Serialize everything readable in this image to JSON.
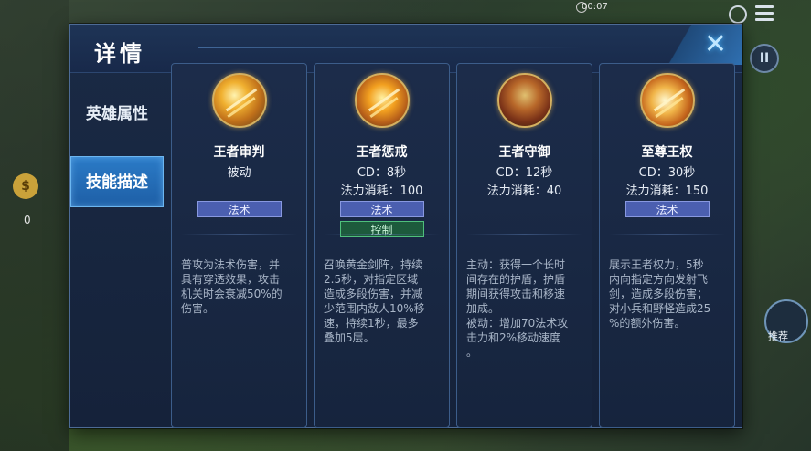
{
  "hud": {
    "time": "00:07",
    "gold_value": "0",
    "right_button_label": "推荐"
  },
  "modal": {
    "title": "详情",
    "nav": [
      {
        "label": "英雄属性"
      },
      {
        "label": "技能描述"
      }
    ],
    "active_nav_index": 1
  },
  "skills": [
    {
      "name": "王者审判",
      "meta_line1": "被动",
      "meta_line2": "",
      "tags": [
        "法术"
      ],
      "description": "普攻为法术伤害，并\n具有穿透效果，攻击\n机关时会衰减50%的\n伤害。"
    },
    {
      "name": "王者惩戒",
      "meta_line1": "CD：8秒",
      "meta_line2": "法力消耗：100",
      "tags": [
        "法术",
        "控制"
      ],
      "description": "召唤黄金剑阵，持续\n2.5秒，对指定区域\n造成多段伤害，并减\n少范围内敌人10%移\n速，持续1秒，最多\n叠加5层。"
    },
    {
      "name": "王者守御",
      "meta_line1": "CD：12秒",
      "meta_line2": "法力消耗：40",
      "tags": [],
      "description": "主动：获得一个长时\n间存在的护盾，护盾\n期间获得攻击和移速\n加成。\n被动：增加70法术攻\n击力和2%移动速度\n。"
    },
    {
      "name": "至尊王权",
      "meta_line1": "CD：30秒",
      "meta_line2": "法力消耗：150",
      "tags": [
        "法术"
      ],
      "description": "展示王者权力，5秒\n内向指定方向发射飞\n剑，造成多段伤害；\n对小兵和野怪造成25\n%的额外伤害。"
    }
  ],
  "colors": {
    "tag_magic": "#4b5fb0",
    "tag_control": "#1d5a3c",
    "nav_active": "#2b7bc7"
  }
}
